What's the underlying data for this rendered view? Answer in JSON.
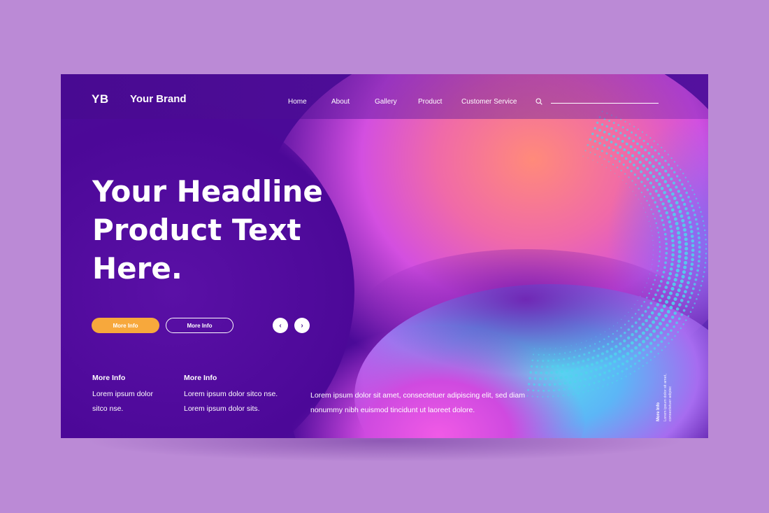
{
  "brand": {
    "mark": "YB",
    "name": "Your Brand"
  },
  "nav": {
    "items": [
      "Home",
      "About",
      "Gallery",
      "Product",
      "Customer Service"
    ]
  },
  "search": {
    "icon": "search-icon"
  },
  "hero": {
    "headline_lines": [
      "Your Headline",
      "Product Text",
      "Here."
    ],
    "primary_button": "More Info",
    "secondary_button": "More Info",
    "prev_icon": "‹",
    "next_icon": "›"
  },
  "info": {
    "col1": {
      "title": "More Info",
      "lines": [
        "Lorem ipsum dolor",
        "sitco nse."
      ]
    },
    "col2": {
      "title": "More Info",
      "lines": [
        "Lorem ipsum dolor sitco nse.",
        "Lorem ipsum dolor sits."
      ]
    },
    "paragraph": [
      "Lorem ipsum dolor sit amet, consectetuer adipiscing elit, sed diam",
      "nonummy nibh euismod tincidunt ut laoreet dolore."
    ]
  },
  "side": {
    "title": "More Info",
    "text": "Lorem ipsum dolor sit amet, consectetuer adipisc"
  },
  "colors": {
    "page_bg": "#bb8ad6",
    "card_bg": "#4b0a98",
    "accent": "#f7a83c"
  }
}
